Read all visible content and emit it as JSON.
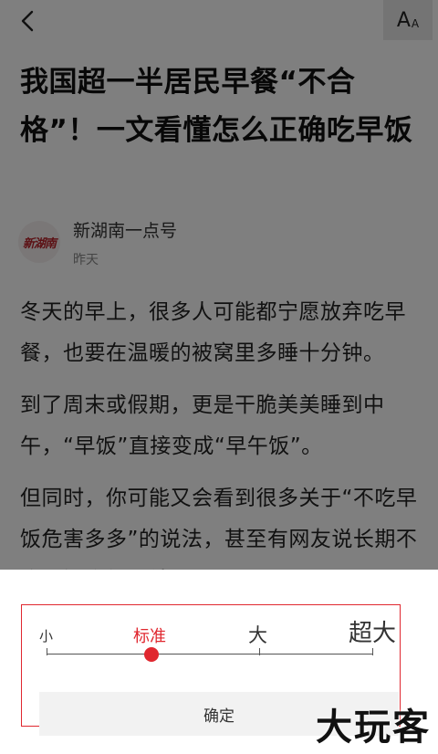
{
  "toolbar": {
    "back_icon": "chevron-left-icon",
    "font_size_icon": "font-size-icon",
    "font_big_glyph": "A",
    "font_small_glyph": "A"
  },
  "article": {
    "title": "我国超一半居民早餐“不合格”！一文看懂怎么正确吃早饭",
    "author": {
      "name": "新湖南一点号",
      "time": "昨天",
      "logo_text": "新湖南"
    },
    "paragraphs": [
      "冬天的早上，很多人可能都宁愿放弃吃早餐，也要在温暖的被窝里多睡十分钟。",
      "到了周末或假期，更是干脆美美睡到中午，“早饭”直接变成“早午饭”。",
      "但同时，你可能又会看到很多关于“不吃早饭危害多多”的说法，甚至有网友说长期不吃早饭会得胆结石。"
    ]
  },
  "font_sheet": {
    "options": [
      "小",
      "标准",
      "大",
      "超大"
    ],
    "selected": "标准",
    "selected_index": 1,
    "confirm_label": "确定",
    "accent_color": "#e0272f"
  },
  "watermark": {
    "text": "大玩客"
  }
}
